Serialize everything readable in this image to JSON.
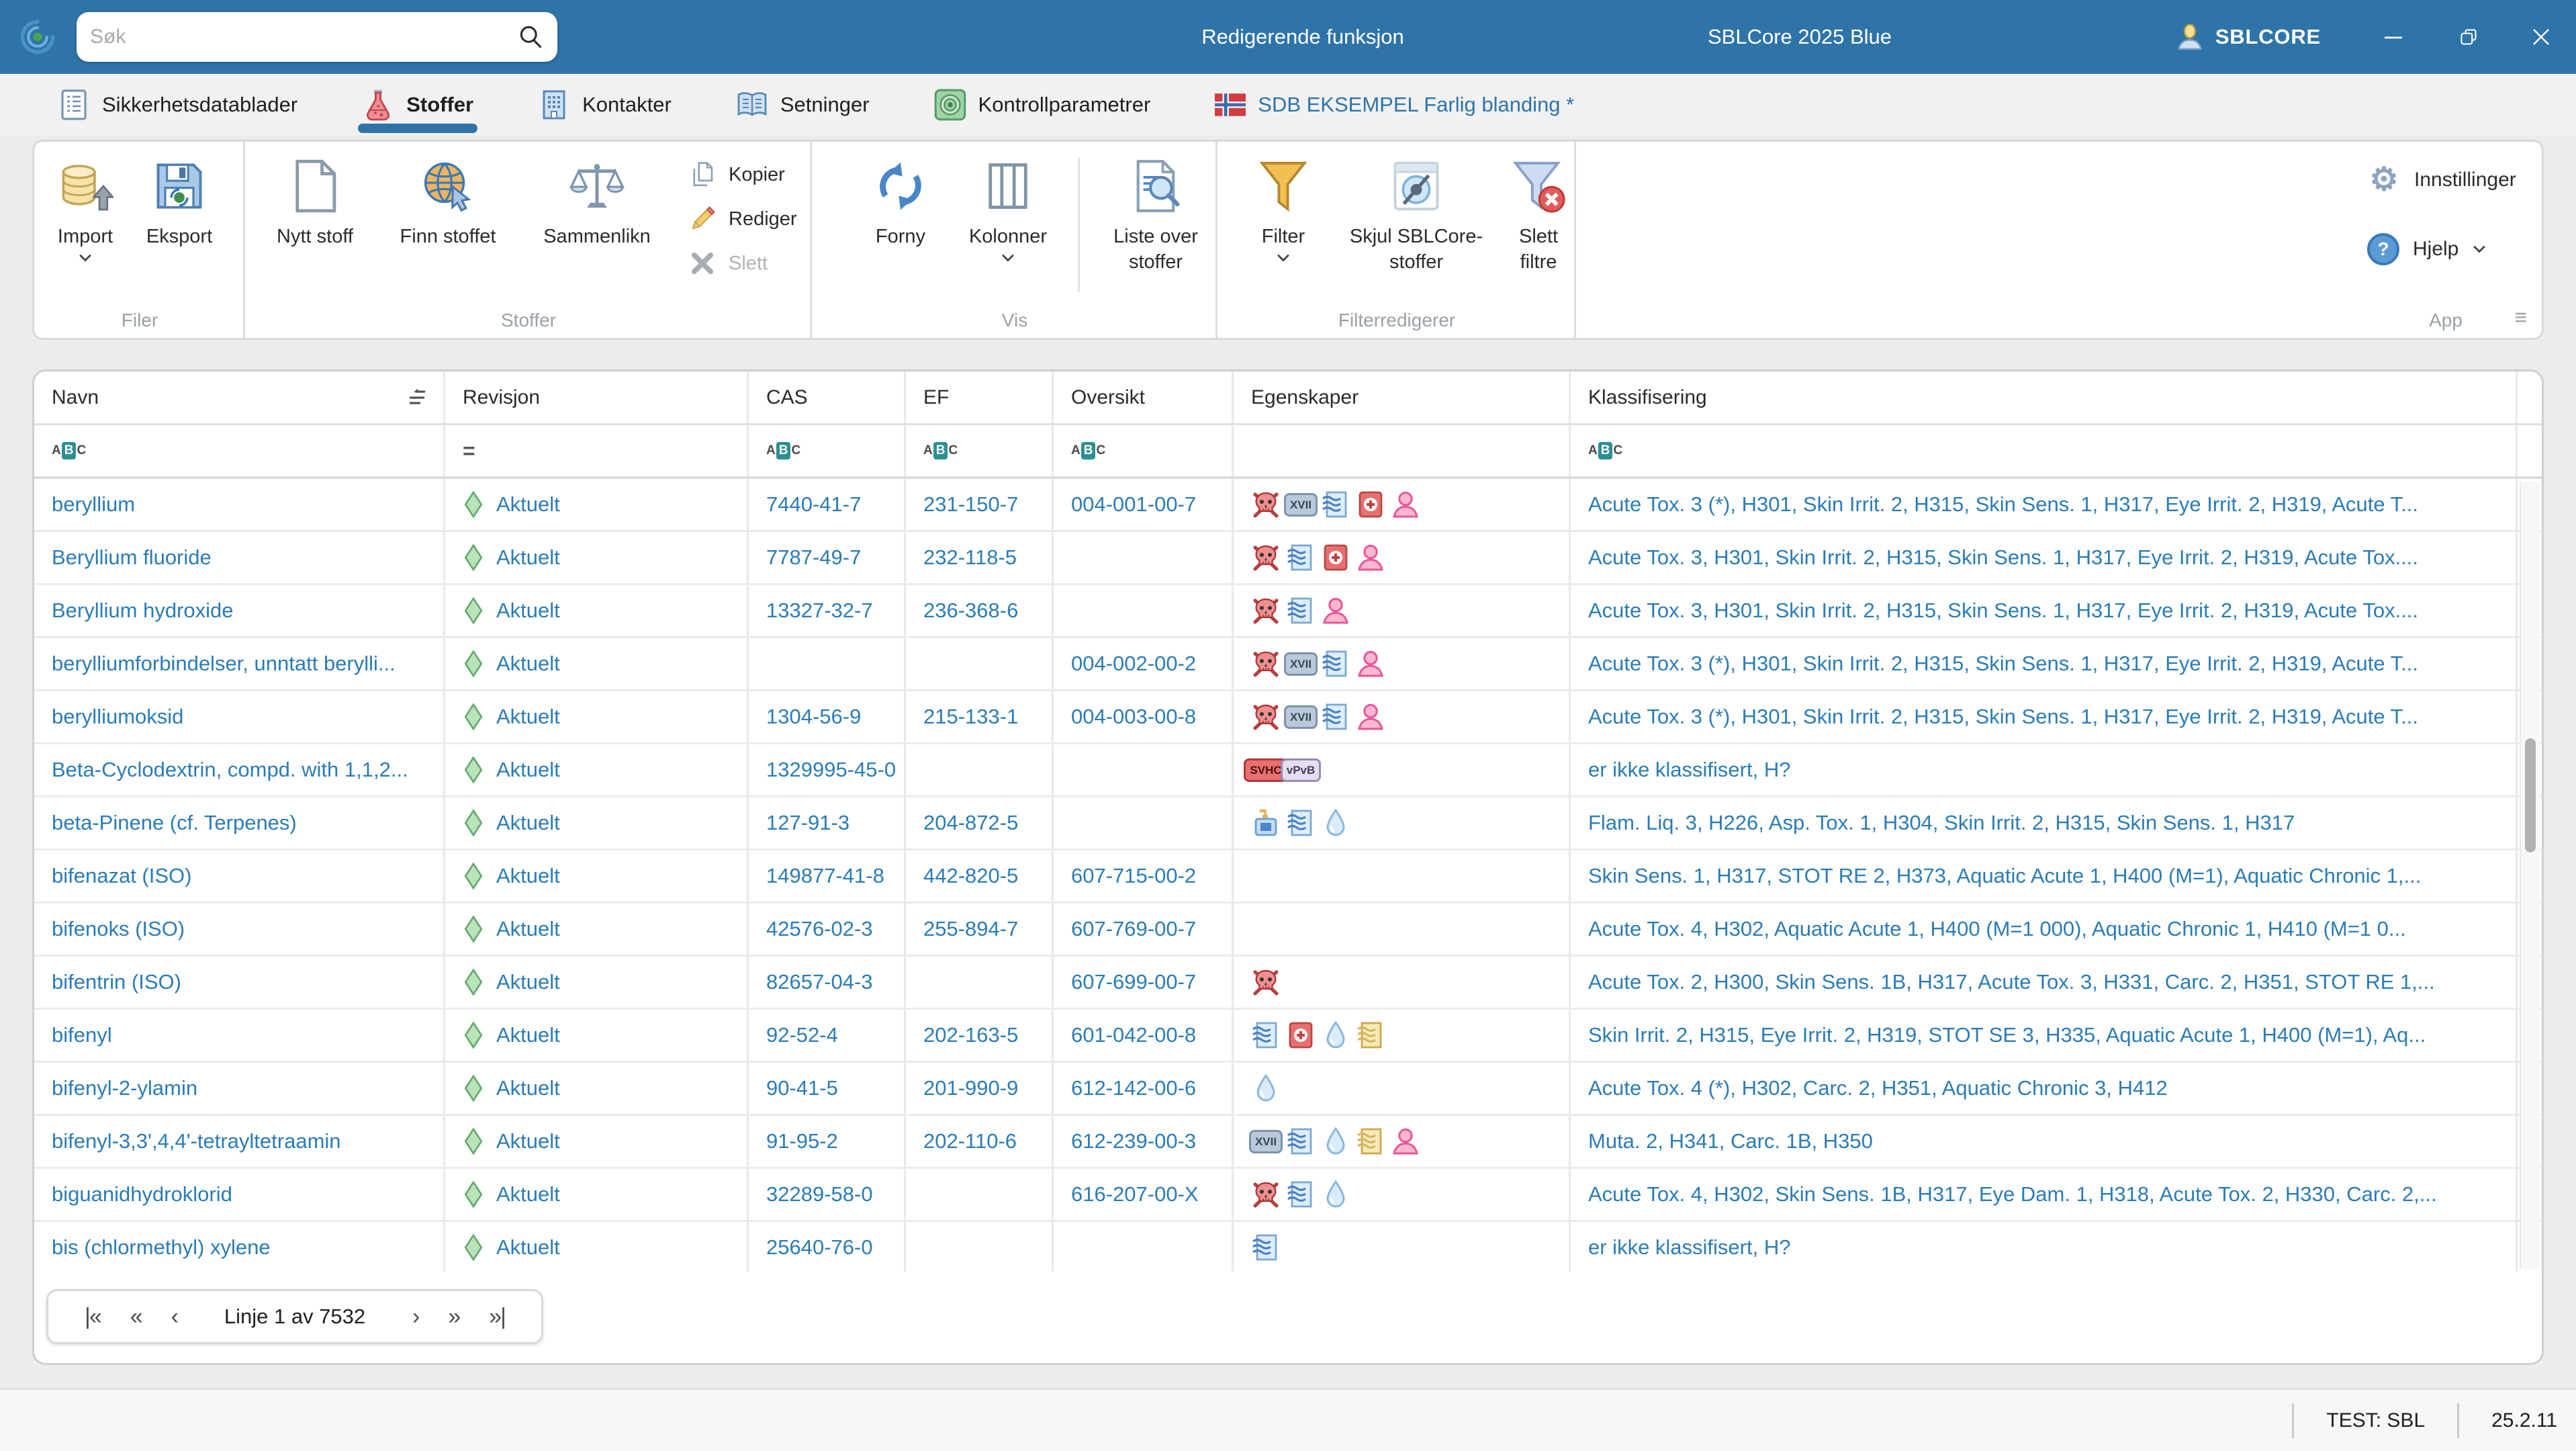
{
  "title_bar": {
    "search_placeholder": "Søk",
    "mode_label": "Redigerende funksjon",
    "app_title": "SBLCore 2025 Blue",
    "account_label": "SBLCORE"
  },
  "tabs": [
    {
      "id": "sikkerhetsdatablader",
      "label": "Sikkerhetsdatablader",
      "icon": "sds-doc",
      "active": false,
      "accent": false
    },
    {
      "id": "stoffer",
      "label": "Stoffer",
      "icon": "flask",
      "active": true,
      "accent": false
    },
    {
      "id": "kontakter",
      "label": "Kontakter",
      "icon": "building",
      "active": false,
      "accent": false
    },
    {
      "id": "setninger",
      "label": "Setninger",
      "icon": "book",
      "active": false,
      "accent": false
    },
    {
      "id": "kontrollparametrer",
      "label": "Kontrollparametrer",
      "icon": "target",
      "active": false,
      "accent": false
    },
    {
      "id": "sdb-eksempel",
      "label": "SDB EKSEMPEL Farlig blanding *",
      "icon": "norway-flag",
      "active": false,
      "accent": true
    }
  ],
  "ribbon": {
    "filer": {
      "label": "Filer",
      "import": "Import",
      "eksport": "Eksport"
    },
    "stoffer": {
      "label": "Stoffer",
      "nytt_stoff": "Nytt stoff",
      "finn_stoffet": "Finn stoffet",
      "sammenlikn": "Sammenlikn",
      "kopier": "Kopier",
      "rediger": "Rediger",
      "slett": "Slett"
    },
    "vis": {
      "label": "Vis",
      "forny": "Forny",
      "kolonner": "Kolonner",
      "liste_over_stoffer": "Liste over stoffer"
    },
    "filterredigerer": {
      "label": "Filterredigerer",
      "filter": "Filter",
      "skjul": "Skjul SBLCore-stoffer",
      "slett_filtre": "Slett filtre"
    },
    "app": {
      "label": "App",
      "innstillinger": "Innstillinger",
      "hjelp": "Hjelp"
    }
  },
  "table": {
    "columns": [
      {
        "id": "navn",
        "label": "Navn",
        "filter": "abc",
        "sort": true
      },
      {
        "id": "revisjon",
        "label": "Revisjon",
        "filter": "eq",
        "sort": false
      },
      {
        "id": "cas",
        "label": "CAS",
        "filter": "abc",
        "sort": false
      },
      {
        "id": "ef",
        "label": "EF",
        "filter": "abc",
        "sort": false
      },
      {
        "id": "oversikt",
        "label": "Oversikt",
        "filter": "abc",
        "sort": false
      },
      {
        "id": "egenskaper",
        "label": "Egenskaper",
        "filter": null,
        "sort": false
      },
      {
        "id": "klassifisering",
        "label": "Klassifisering",
        "filter": "abc",
        "sort": false
      }
    ],
    "rows": [
      {
        "navn": "beryllium",
        "revisjon": "Aktuelt",
        "cas": "7440-41-7",
        "ef": "231-150-7",
        "oversikt": "004-001-00-7",
        "egenskaper": [
          "skull-crossbones",
          "xvii-restriction",
          "exposure-document",
          "first-aid-book",
          "person"
        ],
        "klassifisering": "Acute Tox. 3 (*), H301, Skin Irrit. 2, H315, Skin Sens. 1, H317, Eye Irrit. 2, H319, Acute T..."
      },
      {
        "navn": "Beryllium fluoride",
        "revisjon": "Aktuelt",
        "cas": "7787-49-7",
        "ef": "232-118-5",
        "oversikt": "",
        "egenskaper": [
          "skull-crossbones",
          "exposure-document",
          "first-aid-book",
          "person"
        ],
        "klassifisering": "Acute Tox. 3, H301, Skin Irrit. 2, H315, Skin Sens. 1, H317, Eye Irrit. 2, H319, Acute Tox...."
      },
      {
        "navn": "Beryllium hydroxide",
        "revisjon": "Aktuelt",
        "cas": "13327-32-7",
        "ef": "236-368-6",
        "oversikt": "",
        "egenskaper": [
          "skull-crossbones",
          "exposure-document",
          "person"
        ],
        "klassifisering": "Acute Tox. 3, H301, Skin Irrit. 2, H315, Skin Sens. 1, H317, Eye Irrit. 2, H319, Acute Tox...."
      },
      {
        "navn": "berylliumforbindelser, unntatt berylli...",
        "revisjon": "Aktuelt",
        "cas": "",
        "ef": "",
        "oversikt": "004-002-00-2",
        "egenskaper": [
          "skull-crossbones",
          "xvii-restriction",
          "exposure-document",
          "person"
        ],
        "klassifisering": "Acute Tox. 3 (*), H301, Skin Irrit. 2, H315, Skin Sens. 1, H317, Eye Irrit. 2, H319, Acute T..."
      },
      {
        "navn": "berylliumoksid",
        "revisjon": "Aktuelt",
        "cas": "1304-56-9",
        "ef": "215-133-1",
        "oversikt": "004-003-00-8",
        "egenskaper": [
          "skull-crossbones",
          "xvii-restriction",
          "exposure-document",
          "person"
        ],
        "klassifisering": "Acute Tox. 3 (*), H301, Skin Irrit. 2, H315, Skin Sens. 1, H317, Eye Irrit. 2, H319, Acute T..."
      },
      {
        "navn": "Beta-Cyclodextrin, compd. with 1,1,2...",
        "revisjon": "Aktuelt",
        "cas": "1329995-45-0",
        "ef": "",
        "oversikt": "",
        "egenskaper": [
          "svhc-badge",
          "vpvb-badge"
        ],
        "klassifisering": "er ikke klassifisert, H?"
      },
      {
        "navn": "beta-Pinene (cf. Terpenes)",
        "revisjon": "Aktuelt",
        "cas": "127-91-3",
        "ef": "204-872-5",
        "oversikt": "",
        "egenskaper": [
          "perfume-bottle",
          "exposure-document",
          "water-drop"
        ],
        "klassifisering": "Flam. Liq. 3, H226, Asp. Tox. 1, H304, Skin Irrit. 2, H315, Skin Sens. 1, H317"
      },
      {
        "navn": "bifenazat (ISO)",
        "revisjon": "Aktuelt",
        "cas": "149877-41-8",
        "ef": "442-820-5",
        "oversikt": "607-715-00-2",
        "egenskaper": [],
        "klassifisering": "Skin Sens. 1, H317, STOT RE 2, H373, Aquatic Acute 1, H400 (M=1), Aquatic Chronic 1,..."
      },
      {
        "navn": "bifenoks (ISO)",
        "revisjon": "Aktuelt",
        "cas": "42576-02-3",
        "ef": "255-894-7",
        "oversikt": "607-769-00-7",
        "egenskaper": [],
        "klassifisering": "Acute Tox. 4, H302, Aquatic Acute 1, H400 (M=1 000), Aquatic Chronic 1, H410 (M=1 0..."
      },
      {
        "navn": "bifentrin (ISO)",
        "revisjon": "Aktuelt",
        "cas": "82657-04-3",
        "ef": "",
        "oversikt": "607-699-00-7",
        "egenskaper": [
          "skull-crossbones"
        ],
        "klassifisering": "Acute Tox. 2, H300, Skin Sens. 1B, H317, Acute Tox. 3, H331, Carc. 2, H351, STOT RE 1,..."
      },
      {
        "navn": "bifenyl",
        "revisjon": "Aktuelt",
        "cas": "92-52-4",
        "ef": "202-163-5",
        "oversikt": "601-042-00-8",
        "egenskaper": [
          "exposure-document",
          "first-aid-book",
          "water-drop",
          "yellow-document"
        ],
        "klassifisering": "Skin Irrit. 2, H315, Eye Irrit. 2, H319, STOT SE 3, H335, Aquatic Acute 1, H400 (M=1), Aq..."
      },
      {
        "navn": "bifenyl-2-ylamin",
        "revisjon": "Aktuelt",
        "cas": "90-41-5",
        "ef": "201-990-9",
        "oversikt": "612-142-00-6",
        "egenskaper": [
          "water-drop"
        ],
        "klassifisering": "Acute Tox. 4 (*), H302, Carc. 2, H351, Aquatic Chronic 3, H412"
      },
      {
        "navn": "bifenyl-3,3',4,4'-tetrayltetraamin",
        "revisjon": "Aktuelt",
        "cas": "91-95-2",
        "ef": "202-110-6",
        "oversikt": "612-239-00-3",
        "egenskaper": [
          "xvii-restriction",
          "exposure-document",
          "water-drop",
          "yellow-document",
          "person"
        ],
        "klassifisering": "Muta. 2, H341, Carc. 1B, H350"
      },
      {
        "navn": "biguanidhydroklorid",
        "revisjon": "Aktuelt",
        "cas": "32289-58-0",
        "ef": "",
        "oversikt": "616-207-00-X",
        "egenskaper": [
          "skull-crossbones",
          "exposure-document",
          "water-drop"
        ],
        "klassifisering": "Acute Tox. 4, H302, Skin Sens. 1B, H317, Eye Dam. 1, H318, Acute Tox. 2, H330, Carc. 2,..."
      },
      {
        "navn": "bis (chlormethyl) xylene",
        "revisjon": "Aktuelt",
        "cas": "25640-76-0",
        "ef": "",
        "oversikt": "",
        "egenskaper": [
          "exposure-document"
        ],
        "klassifisering": "er ikke klassifisert, H?"
      }
    ]
  },
  "pagination": {
    "first": "|«",
    "prev_page": "«",
    "prev": "‹",
    "status": "Linje 1 av 7532",
    "next": "›",
    "next_page": "»",
    "last": "»|"
  },
  "status_bar": {
    "environment": "TEST: SBL",
    "version": "25.2.11"
  }
}
